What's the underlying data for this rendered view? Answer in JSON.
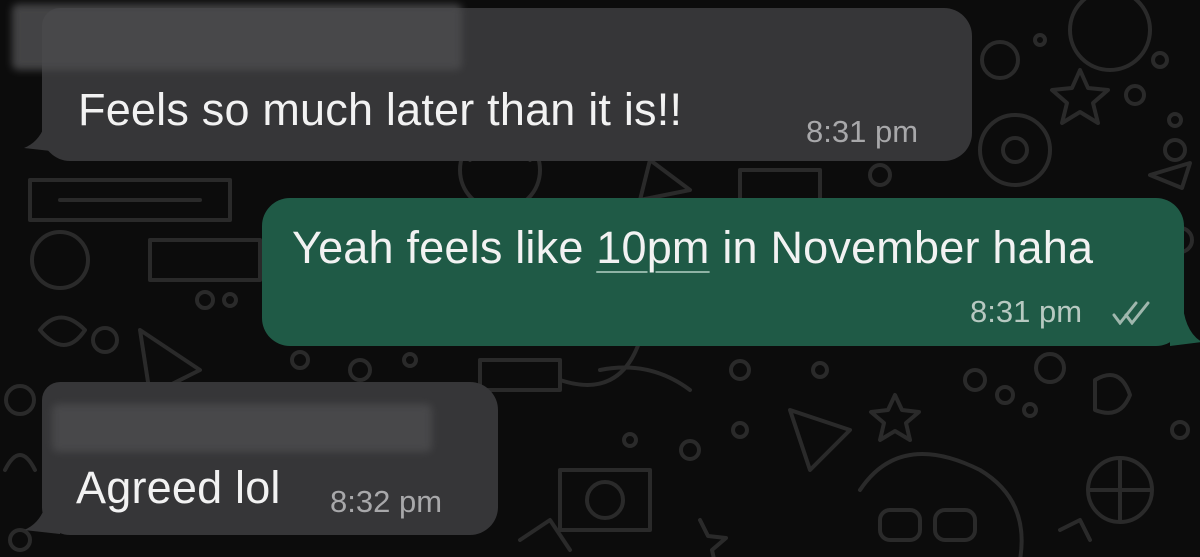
{
  "chat": {
    "theme": {
      "background": "#0c0c0c",
      "incoming_bubble": "#363638",
      "outgoing_bubble": "#1f5a46",
      "text": "#f2f2f2",
      "timestamp": "#a8a8aa"
    },
    "messages": [
      {
        "direction": "incoming",
        "sender": "",
        "text": "Feels so much later than it is!!",
        "time": "8:31 pm"
      },
      {
        "direction": "outgoing",
        "text_before": "Yeah feels like ",
        "text_link": "10pm",
        "text_after": " in November haha",
        "time": "8:31 pm",
        "status_icon": "double-check-icon"
      },
      {
        "direction": "incoming",
        "sender": "",
        "text": "Agreed lol",
        "time": "8:32 pm"
      }
    ]
  }
}
